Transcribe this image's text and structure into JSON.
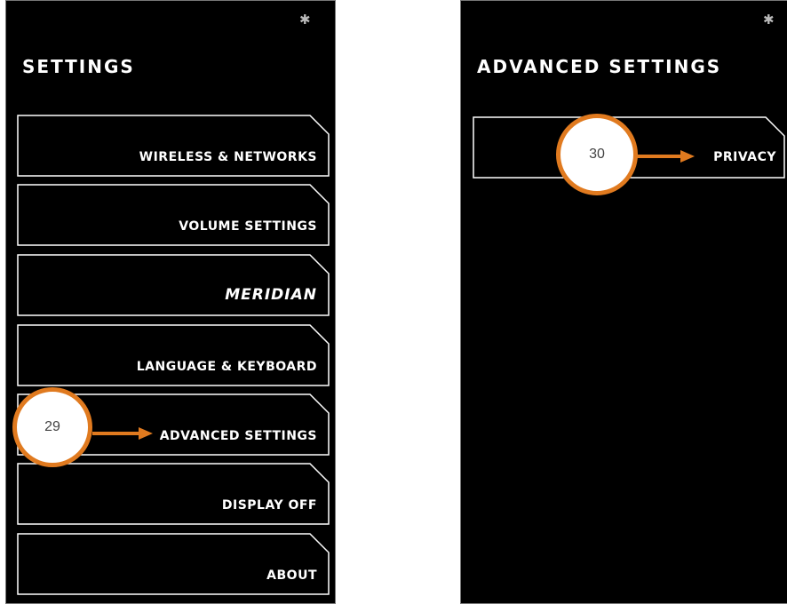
{
  "left_screen": {
    "title": "SETTINGS",
    "bluetooth_icon": "bluetooth-icon",
    "menu_items": [
      {
        "label": "WIRELESS & NETWORKS"
      },
      {
        "label": "VOLUME SETTINGS"
      },
      {
        "label": "MERIDIAN"
      },
      {
        "label": "LANGUAGE & KEYBOARD"
      },
      {
        "label": "ADVANCED SETTINGS"
      },
      {
        "label": "DISPLAY OFF"
      },
      {
        "label": "ABOUT"
      }
    ],
    "callout": {
      "number": "29"
    }
  },
  "right_screen": {
    "title": "ADVANCED SETTINGS",
    "bluetooth_icon": "bluetooth-icon",
    "menu_items": [
      {
        "label": "PRIVACY"
      }
    ],
    "callout": {
      "number": "30"
    }
  },
  "colors": {
    "screen_background": "#000000",
    "callout_border": "#e07a1f",
    "arrow": "#e07a1f",
    "button_outline": "#ffffff"
  }
}
